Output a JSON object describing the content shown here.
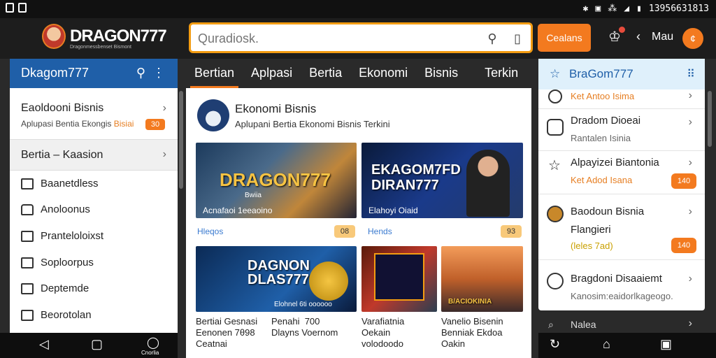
{
  "status_bar": {
    "time": "13956631813"
  },
  "header": {
    "logo_text": "DRAGON777",
    "logo_tagline": "Dragonmessbenset Bismont",
    "search_placeholder": "Quradiosk.",
    "cta_label": "Cealans",
    "menu_label": "Mau",
    "avatar_letter": "¢"
  },
  "left_panel": {
    "title": "Dkagom777",
    "card1": {
      "title": "Eaoldooni Bisnis",
      "sub": "Aplupasi Bentia Ekongis",
      "sub_accent": "Bisiai",
      "badge": "30"
    },
    "card2": {
      "title": "Bertia – Kaasion"
    },
    "items": [
      {
        "label": "Baanetdless"
      },
      {
        "label": "Anoloonus"
      },
      {
        "label": "Pranteloloixst"
      },
      {
        "label": "Soploorpus"
      },
      {
        "label": "Deptemde"
      },
      {
        "label": "Beorotolan"
      }
    ]
  },
  "tabs": [
    {
      "label": "Bertian",
      "active": true
    },
    {
      "label": "Aplpasi"
    },
    {
      "label": "Bertia"
    },
    {
      "label": "Ekonomi"
    },
    {
      "label": "Bisnis"
    },
    {
      "label": "Terkin"
    }
  ],
  "center": {
    "channel_title": "Ekonomi Bisnis",
    "channel_sub": "Aplupani Bertia Ekonomi Bisnis Terkini",
    "cards": [
      {
        "img_text": "DRAGON777",
        "img_sub": "Bwiia",
        "img_caption": "Acnafaoi 1eeaoino",
        "meta": "Hleqos",
        "pill": "08"
      },
      {
        "img_text": "EKAGOM7FD\nDIRAN777",
        "img_caption": "Elahoyi Oiaid",
        "meta": "Hends",
        "pill": "93"
      },
      {
        "img_text": "DAGNON\nDLAS777",
        "img_caption": "Elohnel 6ti oooooo",
        "cap": "Bertiai Gesnasi\nEenonen 7θ98\nCeatnai",
        "cap2": "Penahi  700\nDlayns Voernom"
      },
      {
        "img_text": "",
        "cap": "Varafiatnia\nOekain\nvolodoodo"
      },
      {
        "img_text": "B/ACIOKINIA",
        "cap": "Vanelio Bisenin\nBenniak Ekdoa\nOakin"
      }
    ]
  },
  "right_panel": {
    "title": "BraGom777",
    "items": [
      {
        "title": "",
        "sub": "Ket Antoo Isima"
      },
      {
        "title": "Dradom Dioeai",
        "sub": "Rantalen Isinia"
      },
      {
        "title": "Alpayizei Biantonia",
        "sub": "Ket Adod Isana",
        "badge": "140"
      },
      {
        "title": "Baodoun Bisnia",
        "sub": "Flangieri",
        "sub2": "(leles 7ad)",
        "badge": "140"
      },
      {
        "title": "Bragdoni Disaaiemt",
        "sub": "Kanosim:eaidorlkageogo."
      }
    ],
    "footer": "Nalea"
  },
  "navbar_left": {
    "label": "Cnorlia"
  }
}
